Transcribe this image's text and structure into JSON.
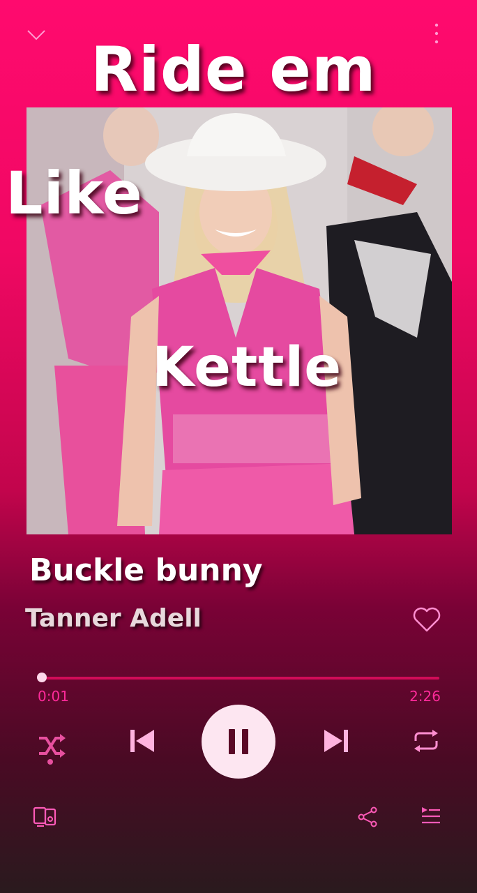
{
  "header": {
    "collapse_icon": "chevron-down-icon",
    "menu_icon": "more-vertical-icon"
  },
  "overlay": {
    "line1": "Ride em",
    "line2": "Like",
    "line3": "Kettle"
  },
  "track": {
    "title": "Buckle bunny",
    "artist": "Tanner Adell",
    "liked": false
  },
  "progress": {
    "current": "0:01",
    "total": "2:26",
    "fraction": 0.007
  },
  "controls": {
    "shuffle_icon": "shuffle-icon",
    "prev_icon": "skip-previous-icon",
    "play_state": "playing",
    "play_icon": "pause-icon",
    "next_icon": "skip-next-icon",
    "repeat_icon": "repeat-icon"
  },
  "footer": {
    "device_icon": "devices-icon",
    "share_icon": "share-icon",
    "queue_icon": "queue-icon"
  },
  "colors": {
    "accent": "#ff2a9a",
    "background_top": "#ff0a6e",
    "background_bottom": "#2a1a1e"
  }
}
